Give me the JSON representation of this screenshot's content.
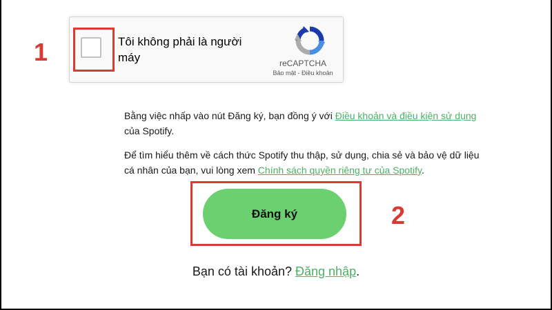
{
  "recaptcha": {
    "label": "Tôi không phải là người máy",
    "brand": "reCAPTCHA",
    "privacy": "Bảo mật",
    "separator": " - ",
    "terms": "Điều khoản"
  },
  "annotations": {
    "step1": "1",
    "step2": "2"
  },
  "terms_paragraph": {
    "before": "Bằng việc nhấp vào nút Đăng ký, bạn đồng ý với ",
    "link": "Điều khoản và điều kiện sử dụng",
    "after": " của Spotify."
  },
  "privacy_paragraph": {
    "before": "Để tìm hiểu thêm về cách thức Spotify thu thập, sử dụng, chia sẻ và bảo vệ dữ liệu cá nhân của bạn, vui lòng xem ",
    "link": "Chính sách quyền riêng tư của Spotify",
    "after": "."
  },
  "signup_button": "Đăng ký",
  "login": {
    "prompt": "Bạn có tài khoản? ",
    "link": "Đăng nhập",
    "after": "."
  },
  "colors": {
    "accent_red": "#d93a32",
    "spotify_green": "#6bd070",
    "link_green": "#4caf63"
  }
}
